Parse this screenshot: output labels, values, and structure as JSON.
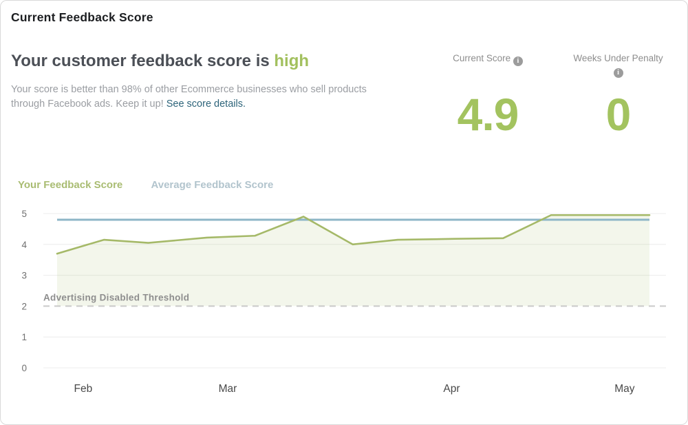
{
  "card": {
    "title": "Current Feedback Score"
  },
  "summary": {
    "headline_prefix": "Your customer feedback score is ",
    "headline_status": "high",
    "description": "Your score is better than 98% of other Ecommerce businesses who sell products through Facebook ads. Keep it up! ",
    "link_label": "See score details."
  },
  "stats": [
    {
      "label": "Current Score",
      "value": "4.9"
    },
    {
      "label": "Weeks Under Penalty",
      "value": "0"
    }
  ],
  "icons": {
    "info": "i"
  },
  "colors": {
    "score_green": "#a3c35f",
    "status_green": "#a2c05e",
    "link_teal": "#2c6379",
    "legend_green": "#a9bc72",
    "legend_blue": "#b2c4cd"
  },
  "chart_data": {
    "type": "line",
    "title": "",
    "xlabel": "",
    "ylabel": "",
    "ylim": [
      0,
      5
    ],
    "yticks": [
      0,
      1,
      2,
      3,
      4,
      5
    ],
    "grid": true,
    "legend_position": "top-left",
    "x_axis": [
      {
        "label": "Feb",
        "pos": 0.044
      },
      {
        "label": "Mar",
        "pos": 0.288
      },
      {
        "label": "Apr",
        "pos": 0.666
      },
      {
        "label": "May",
        "pos": 0.958
      }
    ],
    "series": [
      {
        "name": "Your Feedback Score",
        "color": "#a5b968",
        "fill": "rgba(165,185,104,0.13)",
        "legend_color": "#a9bc72",
        "points": [
          [
            0.0,
            3.7
          ],
          [
            0.079,
            4.15
          ],
          [
            0.154,
            4.05
          ],
          [
            0.253,
            4.22
          ],
          [
            0.334,
            4.28
          ],
          [
            0.416,
            4.9
          ],
          [
            0.499,
            4.0
          ],
          [
            0.575,
            4.15
          ],
          [
            0.671,
            4.18
          ],
          [
            0.753,
            4.2
          ],
          [
            0.834,
            4.95
          ],
          [
            1.0,
            4.95
          ]
        ]
      },
      {
        "name": "Average Feedback Score",
        "color": "#8db6c7",
        "legend_color": "#b2c4cd",
        "points": [
          [
            0.0,
            4.8
          ],
          [
            1.0,
            4.8
          ]
        ]
      }
    ],
    "threshold": {
      "label": "Advertising Disabled Threshold",
      "value": 2,
      "color": "#c9c9c9"
    }
  }
}
